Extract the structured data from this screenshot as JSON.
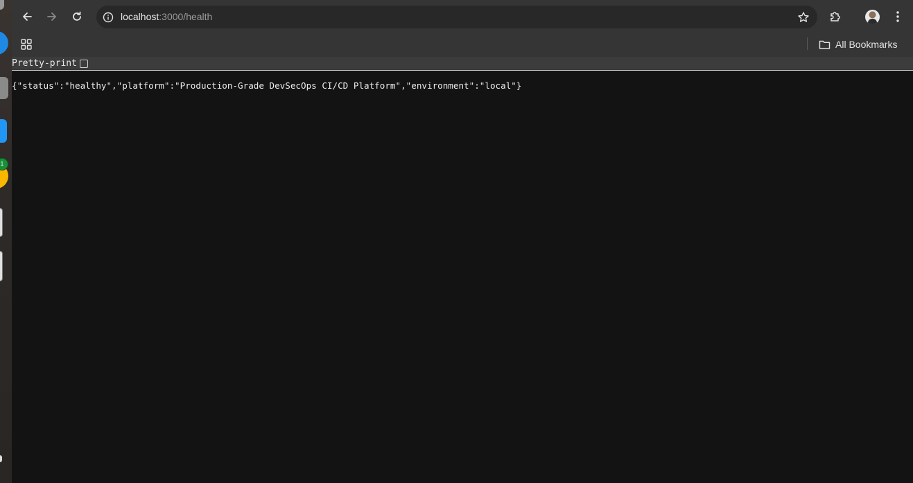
{
  "browser": {
    "url_host": "localhost",
    "url_path": ":3000/health",
    "icons": {
      "back": "arrow-left-icon",
      "forward": "arrow-right-icon",
      "reload": "reload-icon",
      "site_info": "info-icon",
      "bookmark_star": "star-icon",
      "extensions": "puzzle-icon",
      "profile": "avatar",
      "menu": "kebab-menu-icon",
      "apps": "apps-grid-icon",
      "folder": "folder-icon"
    },
    "colors": {
      "toolbar": "#353535",
      "omnibox": "#282828",
      "page_bg": "#131313"
    }
  },
  "bookmarks_bar": {
    "all_bookmarks_label": "All Bookmarks"
  },
  "page": {
    "pretty_print_label": "Pretty-print",
    "pretty_print_checked": false,
    "json_text": "{\"status\":\"healthy\",\"platform\":\"Production-Grade DevSecOps CI/CD Platform\",\"environment\":\"local\"}"
  },
  "dock": {
    "badge_text": "1"
  }
}
